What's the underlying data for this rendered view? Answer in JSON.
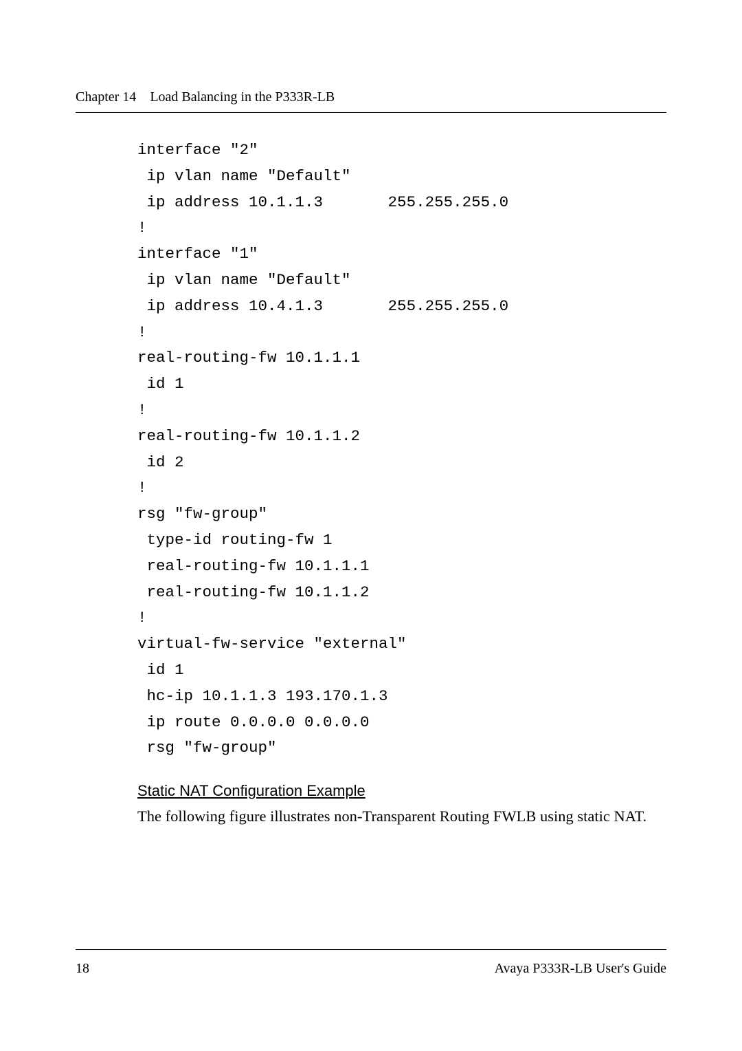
{
  "header": {
    "chapter_label": "Chapter 14",
    "chapter_title": "Load Balancing in the P333R-LB"
  },
  "code": "interface \"2\"\n ip vlan name \"Default\"\n ip address 10.1.1.3       255.255.255.0\n!\ninterface \"1\"\n ip vlan name \"Default\"\n ip address 10.4.1.3       255.255.255.0\n!\nreal-routing-fw 10.1.1.1\n id 1\n!\nreal-routing-fw 10.1.1.2\n id 2\n!\nrsg \"fw-group\"\n type-id routing-fw 1\n real-routing-fw 10.1.1.1\n real-routing-fw 10.1.1.2\n!\nvirtual-fw-service \"external\"\n id 1\n hc-ip 10.1.1.3 193.170.1.3\n ip route 0.0.0.0 0.0.0.0\n rsg \"fw-group\"",
  "section": {
    "heading": "Static NAT Configuration Example",
    "body": "The following figure illustrates non-Transparent Routing FWLB using static NAT."
  },
  "footer": {
    "page_number": "18",
    "doc_title": "Avaya P333R-LB User's Guide"
  }
}
